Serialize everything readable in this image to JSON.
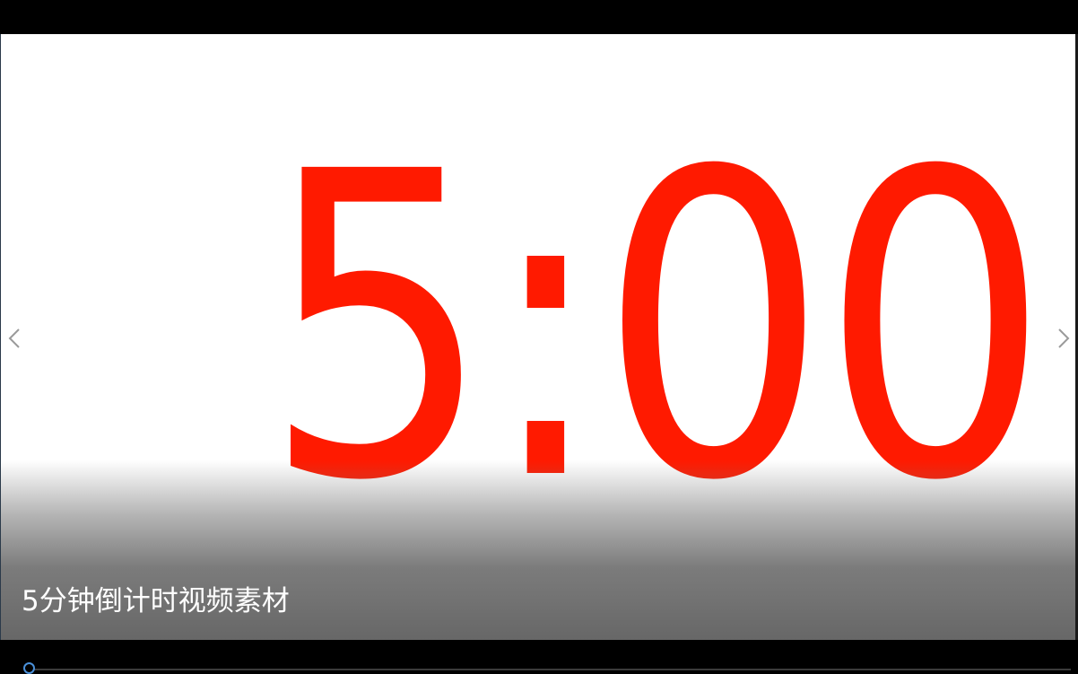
{
  "video": {
    "timer_display": "5:00",
    "caption": "5分钟倒计时视频素材",
    "timer_color": "#ff1a00",
    "progress_fraction": 0.0
  },
  "navigation": {
    "prev_icon": "chevron-left-icon",
    "next_icon": "chevron-right-icon"
  },
  "colors": {
    "accent": "#4a90d9",
    "background": "#000000",
    "frame": "#ffffff"
  }
}
